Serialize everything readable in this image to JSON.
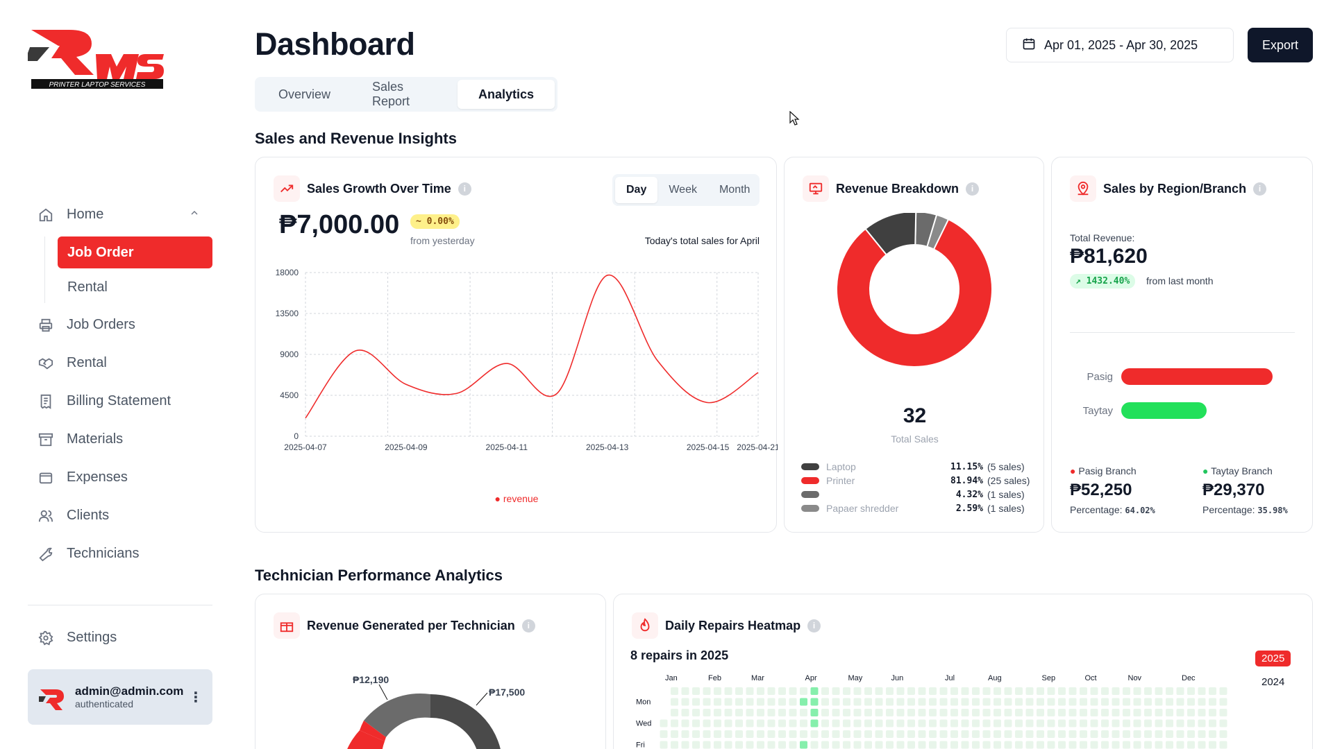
{
  "sidebar": {
    "logo_text": "PRINTER LAPTOP SERVICES",
    "nav": [
      {
        "label": "Home",
        "icon": "home-icon"
      },
      {
        "label": "Job Orders",
        "icon": "printer-icon"
      },
      {
        "label": "Rental",
        "icon": "handshake-icon"
      },
      {
        "label": "Billing Statement",
        "icon": "receipt-icon"
      },
      {
        "label": "Materials",
        "icon": "archive-icon"
      },
      {
        "label": "Expenses",
        "icon": "wallet-icon"
      },
      {
        "label": "Clients",
        "icon": "users-icon"
      },
      {
        "label": "Technicians",
        "icon": "wrench-icon"
      }
    ],
    "home_sub": [
      {
        "label": "Job Order",
        "active": true
      },
      {
        "label": "Rental",
        "active": false
      }
    ],
    "settings_label": "Settings",
    "user": {
      "email": "admin@admin.com",
      "status": "authenticated"
    }
  },
  "header": {
    "title": "Dashboard",
    "tabs": [
      "Overview",
      "Sales Report",
      "Analytics"
    ],
    "active_tab": "Analytics",
    "date_range": "Apr 01, 2025 - Apr 30, 2025",
    "export_label": "Export"
  },
  "sections": {
    "sales": "Sales and Revenue Insights",
    "tech": "Technician Performance Analytics"
  },
  "growth": {
    "title": "Sales Growth Over Time",
    "segments": [
      "Day",
      "Week",
      "Month"
    ],
    "active_segment": "Day",
    "value": "₱7,000.00",
    "change": "~ 0.00%",
    "change_note": "from yesterday",
    "note": "Today's total sales for April",
    "legend": "revenue",
    "accent": "#ef2b2b"
  },
  "breakdown": {
    "title": "Revenue Breakdown",
    "total": "32",
    "total_label": "Total Sales",
    "items": [
      {
        "name": "Laptop",
        "pct": "11.15%",
        "count": "(5 sales)",
        "color": "#404040"
      },
      {
        "name": "Printer",
        "pct": "81.94%",
        "count": "(25 sales)",
        "color": "#ef2b2b"
      },
      {
        "name": "",
        "pct": "4.32%",
        "count": "(1 sales)",
        "color": "#6b6b6b"
      },
      {
        "name": "Papaer shredder",
        "pct": "2.59%",
        "count": "(1 sales)",
        "color": "#8a8a8a"
      }
    ]
  },
  "region": {
    "title": "Sales by Region/Branch",
    "total_label": "Total Revenue:",
    "total": "₱81,620",
    "change": "↗ 1432.40%",
    "change_note": "from last month",
    "bars": [
      {
        "label": "Pasig",
        "value": 52250,
        "color": "#ef2b2b"
      },
      {
        "label": "Taytay",
        "value": 29370,
        "color": "#22e05a"
      }
    ],
    "branches": [
      {
        "name": "Pasig Branch",
        "amount": "₱52,250",
        "pct_label": "Percentage:",
        "pct": "64.02%",
        "color": "#ef2b2b"
      },
      {
        "name": "Taytay Branch",
        "amount": "₱29,370",
        "pct_label": "Percentage:",
        "pct": "35.98%",
        "color": "#22c55e"
      }
    ]
  },
  "tech_revenue": {
    "title": "Revenue Generated per Technician",
    "labels": [
      "₱12,190",
      "₱17,500"
    ]
  },
  "heatmap": {
    "title": "Daily Repairs Heatmap",
    "summary": "8 repairs in 2025",
    "years": [
      "2025",
      "2024"
    ],
    "active_year": "2025",
    "months": [
      "Jan",
      "Feb",
      "Mar",
      "Apr",
      "May",
      "Jun",
      "Jul",
      "Aug",
      "Sep",
      "Oct",
      "Nov",
      "Dec"
    ],
    "days": [
      "Mon",
      "Wed",
      "Fri"
    ]
  },
  "chart_data": {
    "type": "line",
    "title": "Sales Growth Over Time",
    "x": [
      "2025-04-07",
      "2025-04-08",
      "2025-04-09",
      "2025-04-10",
      "2025-04-11",
      "2025-04-12",
      "2025-04-13",
      "2025-04-14",
      "2025-04-15",
      "2025-04-21"
    ],
    "series": [
      {
        "name": "revenue",
        "values": [
          2000,
          9400,
          5700,
          4700,
          8000,
          4700,
          17700,
          8300,
          3700,
          7000
        ]
      }
    ],
    "x_ticks": [
      "2025-04-07",
      "2025-04-09",
      "2025-04-11",
      "2025-04-13",
      "2025-04-15",
      "2025-04-21"
    ],
    "y_ticks": [
      "0",
      "4500",
      "9000",
      "13500",
      "18000"
    ],
    "ylim": [
      0,
      18000
    ],
    "grid": true,
    "legend": "bottom"
  }
}
